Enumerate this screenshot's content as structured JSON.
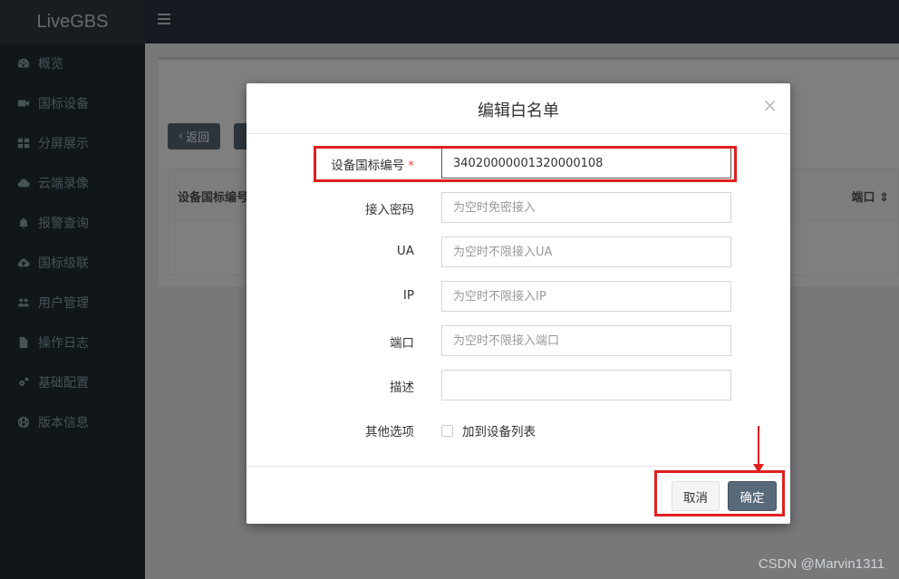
{
  "app": {
    "logo": "LiveGBS"
  },
  "sidebar": {
    "items": [
      {
        "label": "概览",
        "icon": "dashboard-icon"
      },
      {
        "label": "国标设备",
        "icon": "video-camera-icon"
      },
      {
        "label": "分屏展示",
        "icon": "grid-icon"
      },
      {
        "label": "云端录像",
        "icon": "cloud-icon"
      },
      {
        "label": "报警查询",
        "icon": "bell-icon"
      },
      {
        "label": "国标级联",
        "icon": "cloud-upload-icon"
      },
      {
        "label": "用户管理",
        "icon": "users-icon"
      },
      {
        "label": "操作日志",
        "icon": "file-icon"
      },
      {
        "label": "基础配置",
        "icon": "cogs-icon"
      },
      {
        "label": "版本信息",
        "icon": "globe-icon"
      }
    ]
  },
  "background": {
    "back_label": "返回",
    "col_device_id": "设备国标编号",
    "col_port": "端口"
  },
  "modal": {
    "title": "编辑白名单",
    "close": "×",
    "fields": {
      "device_id": {
        "label": "设备国标编号",
        "required": "*",
        "value": "34020000001320000108"
      },
      "password": {
        "label": "接入密码",
        "placeholder": "为空时免密接入"
      },
      "ua": {
        "label": "UA",
        "placeholder": "为空时不限接入UA"
      },
      "ip": {
        "label": "IP",
        "placeholder": "为空时不限接入IP"
      },
      "port": {
        "label": "端口",
        "placeholder": "为空时不限接入端口"
      },
      "desc": {
        "label": "描述",
        "placeholder": ""
      },
      "other": {
        "label": "其他选项",
        "checkbox_label": "加到设备列表"
      }
    },
    "cancel_label": "取消",
    "ok_label": "确定"
  },
  "watermark": "CSDN @Marvin1311",
  "colors": {
    "annotation": "#e02020",
    "sidebar": "#222d32",
    "primary_button": "#58697a"
  }
}
